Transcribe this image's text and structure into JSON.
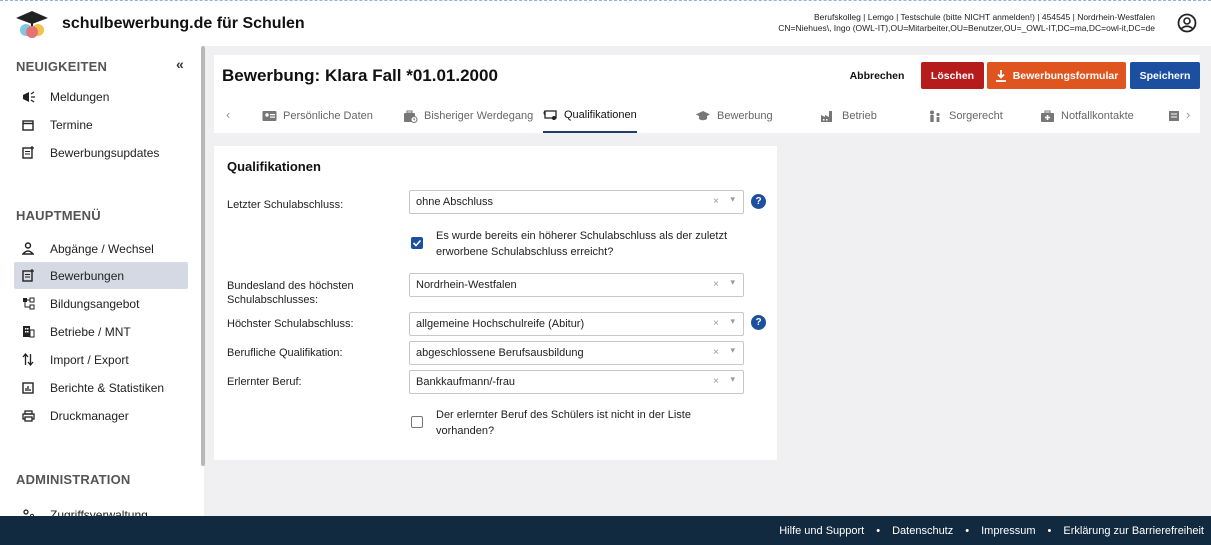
{
  "app": {
    "title": "schulbewerbung.de für Schulen",
    "user_line1": "Berufskolleg | Lemgo | Testschule (bitte NICHT anmelden!) | 454545 | Nordrhein-Westfalen",
    "user_line2": "CN=Niehues\\, Ingo (OWL-IT),OU=Mitarbeiter,OU=Benutzer,OU=_OWL-IT,DC=ma,DC=owl-it,DC=de"
  },
  "sidebar": {
    "news_heading": "NEUIGKEITEN",
    "collapse_glyph": "«",
    "news_items": [
      {
        "label": "Meldungen",
        "icon": "megaphone-icon"
      },
      {
        "label": "Termine",
        "icon": "calendar-icon"
      },
      {
        "label": "Bewerbungsupdates",
        "icon": "update-icon"
      }
    ],
    "main_heading": "HAUPTMENÜ",
    "main_items": [
      {
        "label": "Abgänge / Wechsel",
        "icon": "person-icon"
      },
      {
        "label": "Bewerbungen",
        "icon": "application-icon",
        "active": true
      },
      {
        "label": "Bildungsangebot",
        "icon": "hierarchy-icon"
      },
      {
        "label": "Betriebe / MNT",
        "icon": "building-icon"
      },
      {
        "label": "Import / Export",
        "icon": "import-export-icon"
      },
      {
        "label": "Berichte & Statistiken",
        "icon": "chart-icon"
      },
      {
        "label": "Druckmanager",
        "icon": "printer-icon"
      }
    ],
    "admin_heading": "ADMINISTRATION",
    "admin_items": [
      {
        "label": "Zugriffsverwaltung",
        "icon": "users-key-icon"
      }
    ]
  },
  "header": {
    "title": "Bewerbung: Klara Fall *01.01.2000",
    "cancel_label": "Abbrechen",
    "delete_label": "Löschen",
    "form_label": "Bewerbungsformular",
    "save_label": "Speichern"
  },
  "tabs": [
    {
      "label": "Persönliche Daten",
      "icon": "id-card-icon"
    },
    {
      "label": "Bisheriger Werdegang",
      "icon": "history-icon"
    },
    {
      "label": "Qualifikationen",
      "icon": "diploma-icon",
      "active": true
    },
    {
      "label": "Bewerbung",
      "icon": "graduation-cap-icon"
    },
    {
      "label": "Betrieb",
      "icon": "factory-icon"
    },
    {
      "label": "Sorgerecht",
      "icon": "family-icon"
    },
    {
      "label": "Notfallkontakte",
      "icon": "first-aid-icon"
    }
  ],
  "form": {
    "title": "Qualifikationen",
    "last_degree_label": "Letzter Schulabschluss:",
    "last_degree_value": "ohne Abschluss",
    "higher_degree_checkbox": {
      "checked": true,
      "text": "Es wurde bereits ein höherer Schulabschluss als der zuletzt erworbene Schulabschluss erreicht?"
    },
    "state_label": "Bundesland des höchsten Schulabschlusses:",
    "state_value": "Nordrhein-Westfalen",
    "highest_degree_label": "Höchster Schulabschluss:",
    "highest_degree_value": "allgemeine Hochschulreife (Abitur)",
    "vocational_label": "Berufliche Qualifikation:",
    "vocational_value": "abgeschlossene Berufsausbildung",
    "profession_label": "Erlernter Beruf:",
    "profession_value": "Bankkaufmann/-frau",
    "profession_missing_checkbox": {
      "checked": false,
      "text": "Der erlernter Beruf des Schülers ist nicht in der Liste vorhanden?"
    },
    "clear_glyph": "×",
    "caret_glyph": "▾",
    "help_glyph": "?"
  },
  "footer": {
    "links": [
      "Hilfe und Support",
      "Datenschutz",
      "Impressum",
      "Erklärung zur Barrierefreiheit"
    ],
    "separator": "•"
  },
  "colors": {
    "danger": "#b71c1c",
    "orange": "#e0541f",
    "primary": "#1c4fa0",
    "footer": "#112a40"
  }
}
